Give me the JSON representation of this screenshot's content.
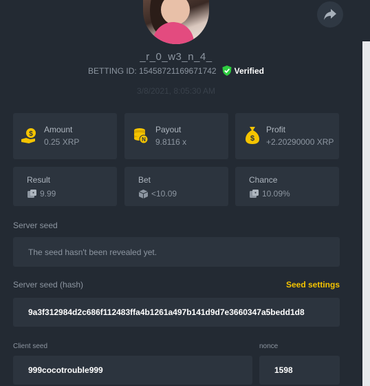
{
  "header": {
    "username": "_r_0_w3_n_4_",
    "bet_id": "BETTING ID: 15458721169671742",
    "verified_label": "Verified",
    "datetime": "3/8/2021, 8:05:30 AM"
  },
  "stats": {
    "amount": {
      "label": "Amount",
      "value": "0.25 XRP",
      "icon": "money-bag-hand-icon"
    },
    "payout": {
      "label": "Payout",
      "value": "9.8116 x",
      "icon": "coin-stack-icon"
    },
    "profit": {
      "label": "Profit",
      "value": "+2.20290000 XRP",
      "icon": "money-bag-icon"
    },
    "result": {
      "label": "Result",
      "value": "9.99",
      "icon": "dice-icon"
    },
    "bet": {
      "label": "Bet",
      "value": "<10.09",
      "icon": "cube-icon"
    },
    "chance": {
      "label": "Chance",
      "value": "10.09%",
      "icon": "dice-icon"
    }
  },
  "server_seed": {
    "label": "Server seed",
    "value": "The seed hasn't been revealed yet."
  },
  "server_seed_hash": {
    "label": "Server seed (hash)",
    "value": "9a3f312984d2c686f112483ffa4b1261a497b141d9d7e3660347a5bedd1d8",
    "settings_link": "Seed settings"
  },
  "client_seed": {
    "label": "Client seed",
    "value": "999cocotrouble999"
  },
  "nonce": {
    "label": "nonce",
    "value": "1598"
  },
  "colors": {
    "accent": "#f5c400",
    "verified": "#2ecc40",
    "background": "#232a33",
    "card": "#2c343e"
  }
}
